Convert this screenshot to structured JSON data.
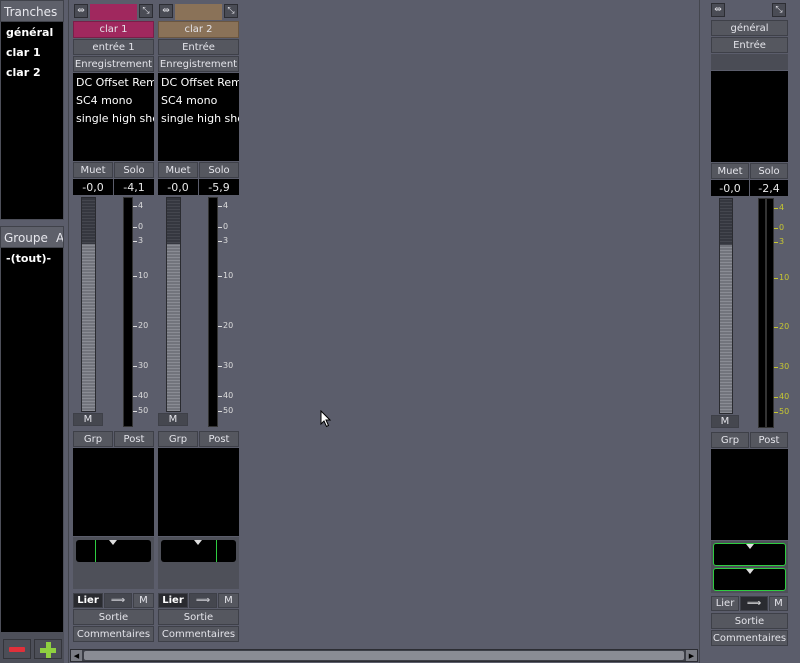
{
  "left_panel": {
    "tranches_title": "Tranches",
    "tranches": [
      "général",
      "clar 1",
      "clar 2"
    ],
    "groups_col1": "Groupe",
    "groups_col2": "A",
    "groups": [
      "-(tout)-"
    ],
    "remove_button": "−",
    "add_button": "+"
  },
  "strips": [
    {
      "name": "clar 1",
      "name_color": "#a0285e",
      "input": "entrée 1",
      "record": "Enregistrement",
      "plugins": [
        "DC Offset Rem",
        "SC4 mono",
        "single high she"
      ],
      "mute": "Muet",
      "solo": "Solo",
      "gain": "-0,0",
      "peak": "-4,1",
      "fader_m": "M",
      "grp": "Grp",
      "post": "Post",
      "link": "Lier",
      "link_m": "M",
      "output": "Sortie",
      "comments": "Commentaires"
    },
    {
      "name": "clar 2",
      "name_color": "#8a7258",
      "input": "Entrée",
      "record": "Enregistrement",
      "plugins": [
        "DC Offset Rem",
        "SC4 mono",
        "single high she"
      ],
      "mute": "Muet",
      "solo": "Solo",
      "gain": "-0,0",
      "peak": "-5,9",
      "fader_m": "M",
      "grp": "Grp",
      "post": "Post",
      "link": "Lier",
      "link_m": "M",
      "output": "Sortie",
      "comments": "Commentaires"
    }
  ],
  "master": {
    "name": "général",
    "input": "Entrée",
    "mute": "Muet",
    "solo": "Solo",
    "gain": "-0,0",
    "peak": "-2,4",
    "fader_m": "M",
    "grp": "Grp",
    "post": "Post",
    "link": "Lier",
    "link_m": "M",
    "output": "Sortie",
    "comments": "Commentaires"
  },
  "meter_scale": [
    "4",
    "0",
    "3",
    "10",
    "20",
    "30",
    "40",
    "50"
  ],
  "colors": {
    "background": "#5b5d6b",
    "white_tick": "#dddddd",
    "master_tick": "#c8c830",
    "pan_indicator": "#2ecc40"
  },
  "icons": {
    "width_toggle": "⇹",
    "hide_strip": "⤡",
    "link_arrow": "⟹",
    "scroll_left": "◀",
    "scroll_right": "▶"
  }
}
